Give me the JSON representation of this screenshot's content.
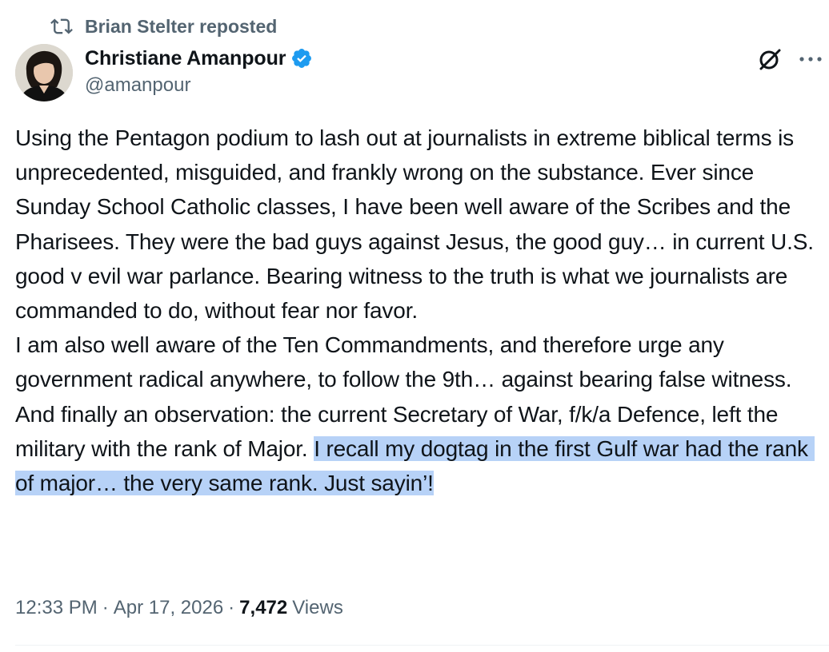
{
  "repost": {
    "label": "Brian Stelter reposted",
    "icon": "repost-icon"
  },
  "author": {
    "name": "Christiane Amanpour",
    "handle": "@amanpour",
    "verified": true,
    "badge_color": "#1d9bf0"
  },
  "actions": {
    "grok_icon": "grok-icon",
    "more_icon": "more-icon"
  },
  "tweet": {
    "para1": "Using the Pentagon podium to lash out at journalists in extreme biblical terms is unprecedented, misguided, and frankly wrong on the substance. Ever since Sunday School Catholic classes, I have been well aware of the Scribes and the Pharisees. They were the bad guys against Jesus, the good guy… in current U.S. good v evil war parlance. Bearing witness to the truth is what we journalists are commanded to do, without fear nor favor.",
    "para2": "I am also well aware of the Ten Commandments, and therefore urge any government radical anywhere, to follow the 9th… against bearing false witness.",
    "para3_plain": "And finally an observation: the current Secretary of War, f/k/a Defence, left the military with the rank of Major. ",
    "para3_highlight": "I recall my dogtag in the first Gulf war had the rank of major… the very same rank. Just sayin’!"
  },
  "meta": {
    "time": "12:33 PM",
    "separator": "·",
    "date": "Apr 17, 2026",
    "views_count": "7,472",
    "views_label": "Views"
  },
  "colors": {
    "text": "#0f1419",
    "secondary": "#536471",
    "highlight": "#b7d2f7",
    "divider": "#eff3f4"
  }
}
